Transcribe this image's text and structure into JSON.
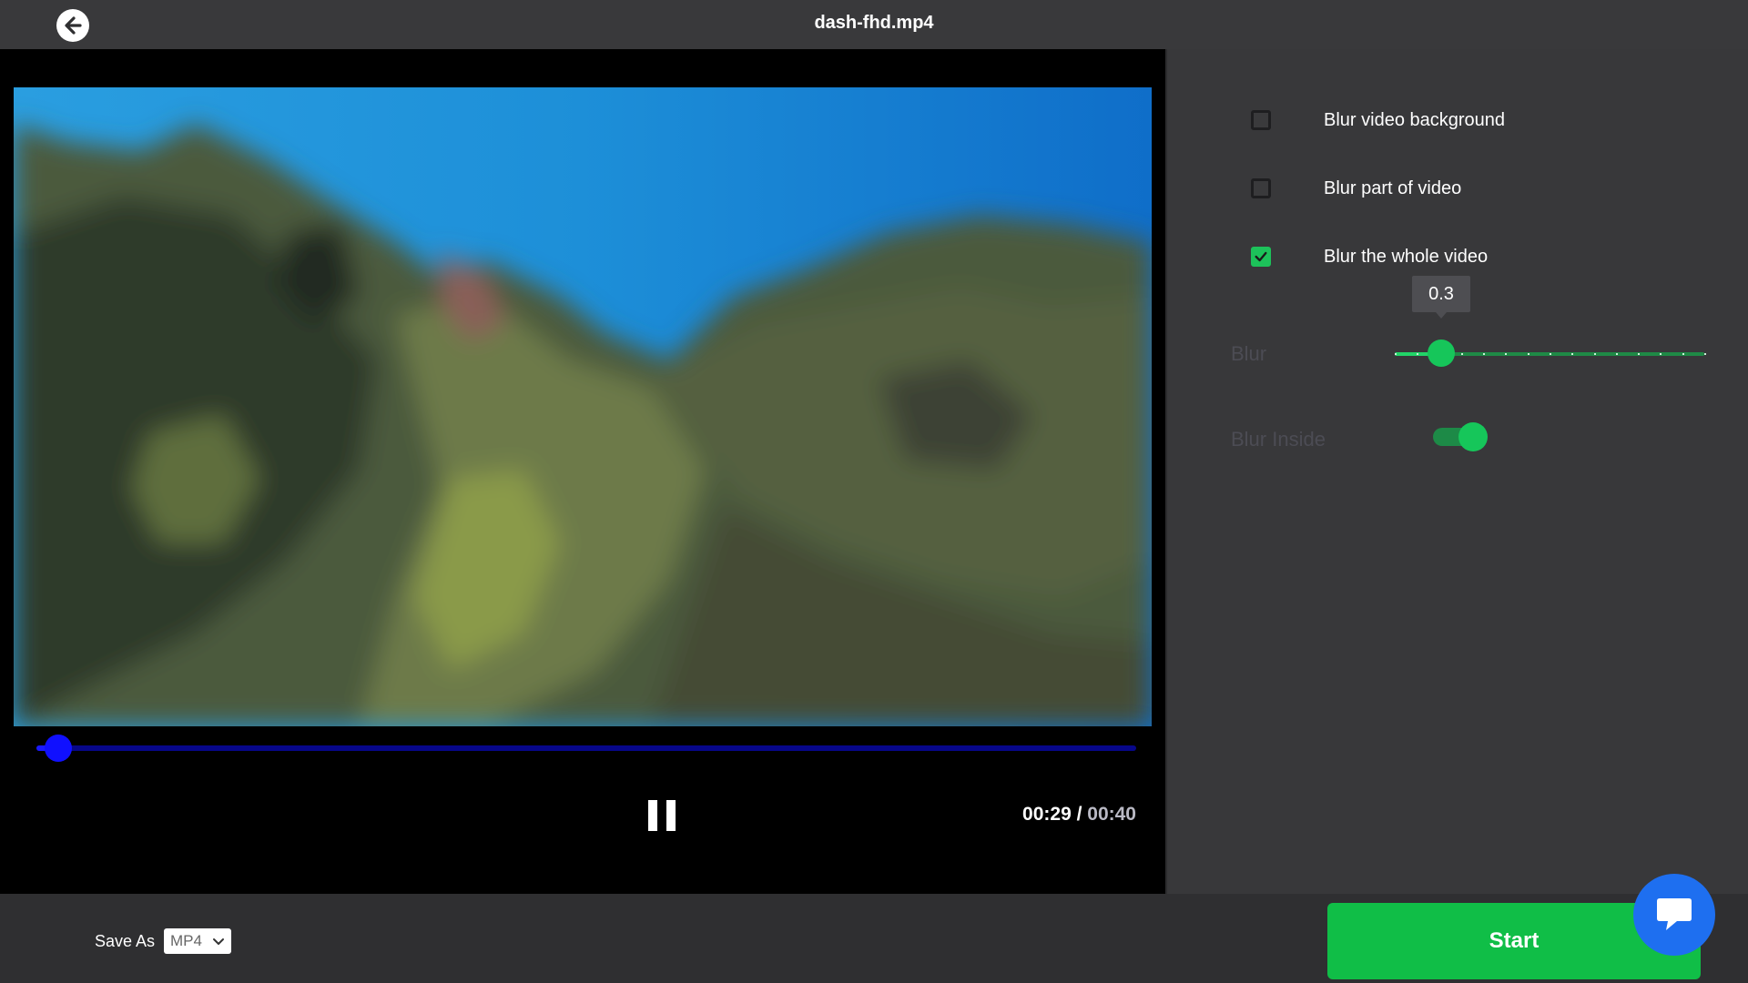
{
  "header": {
    "title": "dash-fhd.mp4",
    "back_icon": "arrow-left-icon"
  },
  "player": {
    "progress": 0.02,
    "time_current": "00:29",
    "time_separator": " / ",
    "time_total": "00:40",
    "play_state_icon": "pause-icon"
  },
  "options": [
    {
      "label": "Blur video background",
      "checked": false
    },
    {
      "label": "Blur part of video",
      "checked": false
    },
    {
      "label": "Blur the whole video",
      "checked": true
    }
  ],
  "blur": {
    "label": "Blur",
    "value": 0.3,
    "display_value": "0.3",
    "min": 0,
    "max": 2
  },
  "blur_inside": {
    "label": "Blur Inside",
    "on": true
  },
  "footer": {
    "save_as_label": "Save As",
    "format": "MP4",
    "start_label": "Start"
  },
  "colors": {
    "accent": "#10be47",
    "progress": "#1010ff",
    "chat": "#1e6ff0"
  },
  "chat_icon": "chat-bubble-icon"
}
